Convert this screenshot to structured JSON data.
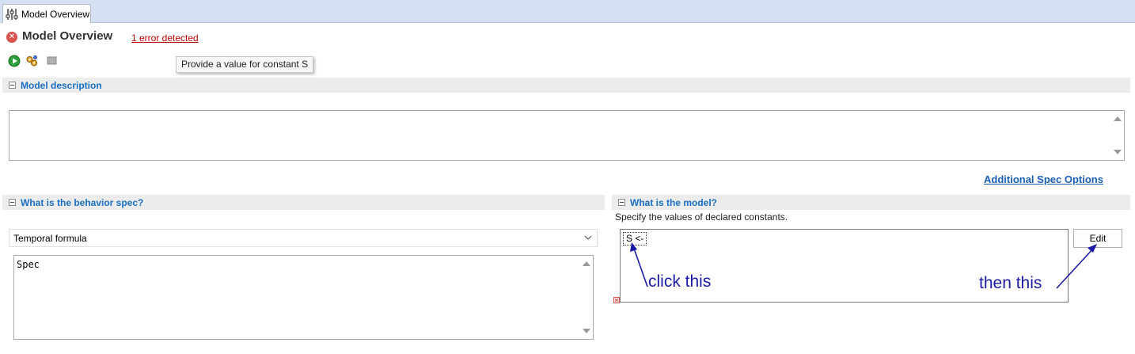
{
  "tab": {
    "label": "Model Overview",
    "icon": "sliders-icon"
  },
  "header": {
    "title": "Model Overview",
    "error_link": "1 error detected",
    "error_icon": "error-icon"
  },
  "toolbar": {
    "run_icon": "run-icon",
    "check_icon": "model-checking-icon",
    "stop_icon": "stop-icon"
  },
  "tooltip": {
    "text": "Provide a value for constant S"
  },
  "description_section": {
    "title": "Model description",
    "value": ""
  },
  "additional_spec_link": "Additional Spec Options",
  "behavior_section": {
    "title": "What is the behavior spec?",
    "selected_option": "Temporal formula",
    "formula": "Spec"
  },
  "model_section": {
    "title": "What is the model?",
    "hint": "Specify the values of declared constants.",
    "constants": [
      "S <-"
    ],
    "edit_label": "Edit"
  },
  "annotations": {
    "click_this": "click this",
    "then_this": "then this"
  },
  "colors": {
    "accent_blue": "#1a6fc4",
    "error_red": "#c00000",
    "annotation_blue": "#1a1aa6",
    "tab_strip": "#d5e1f2"
  }
}
